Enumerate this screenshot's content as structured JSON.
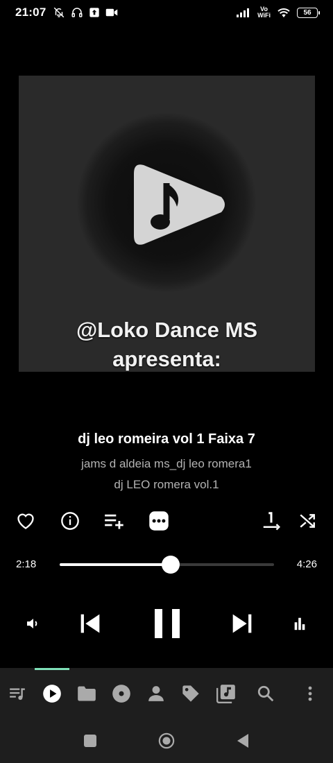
{
  "status_bar": {
    "time": "21:07",
    "volte_top": "Vo",
    "volte_bottom": "WiFi",
    "battery": "56"
  },
  "art": {
    "caption_line1": "@Loko Dance MS",
    "caption_line2": "apresenta:"
  },
  "track": {
    "title": "dj leo romeira vol 1 Faixa 7",
    "artist": "jams d aldeia ms_dj leo romera1",
    "album": "dj LEO  romera vol.1"
  },
  "progress": {
    "elapsed": "2:18",
    "total": "4:26",
    "fraction": 0.518
  },
  "actions": [
    "heart-icon",
    "info-icon",
    "add-to-playlist-icon",
    "more-icon",
    "repeat-one-icon",
    "shuffle-icon"
  ],
  "bottom_nav": [
    "queue-icon",
    "now-playing-icon",
    "folder-icon",
    "album-icon",
    "artist-icon",
    "tag-icon",
    "library-icon",
    "search-icon",
    "overflow-menu-icon"
  ],
  "colors": {
    "background": "#000000",
    "accent": "#7fe0b8",
    "nav_background": "#1e1e1e"
  }
}
